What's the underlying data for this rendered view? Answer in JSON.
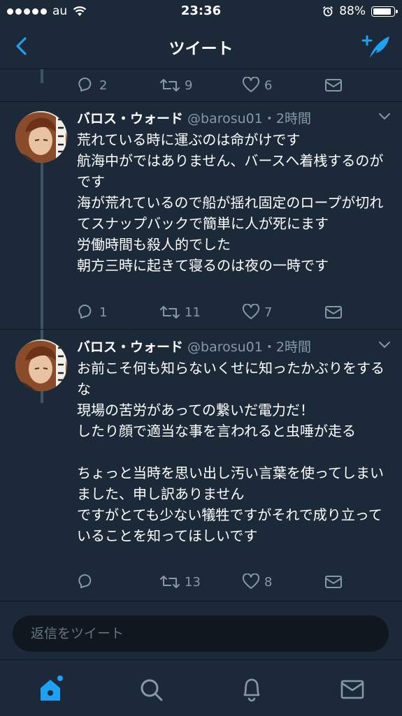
{
  "status_bar": {
    "carrier": "au",
    "time": "23:36",
    "battery_percent": "88%"
  },
  "nav": {
    "title": "ツイート",
    "back_icon": "chevron-left-icon",
    "compose_icon": "compose-tweet-icon"
  },
  "prev_tweet_actions": {
    "replies": "2",
    "retweets": "9",
    "likes": "6"
  },
  "tweets": [
    {
      "name": "バロス・ウォード",
      "handle": "@barosu01",
      "time": "・2時間",
      "body": "荒れている時に運ぶのは命がけです\n航海中がではありません、バースへ着桟するのがです\n海が荒れているので船が揺れ固定のロープが切れてスナップバックで簡単に人が死にます\n労働時間も殺人的でした\n朝方三時に起きて寝るのは夜の一時です",
      "replies": "1",
      "retweets": "11",
      "likes": "7"
    },
    {
      "name": "バロス・ウォード",
      "handle": "@barosu01",
      "time": "・2時間",
      "body": "お前こそ何も知らないくせに知ったかぶりをするな\n現場の苦労があっての繋いだ電力だ！\nしたり顔で適当な事を言われると虫唾が走る\n\nちょっと当時を思い出し汚い言葉を使ってしまいました、申し訳ありません\nですがとても少ない犠牲ですがそれで成り立っていることを知ってほしいです",
      "replies": "",
      "retweets": "13",
      "likes": "8"
    }
  ],
  "reply_bar": {
    "placeholder": "返信をツイート"
  },
  "tab_bar": {
    "items": [
      "home-icon",
      "search-icon",
      "notifications-icon",
      "messages-icon"
    ]
  },
  "colors": {
    "background": "#1c2938",
    "accent": "#1da1f2",
    "muted": "#8899a6"
  }
}
